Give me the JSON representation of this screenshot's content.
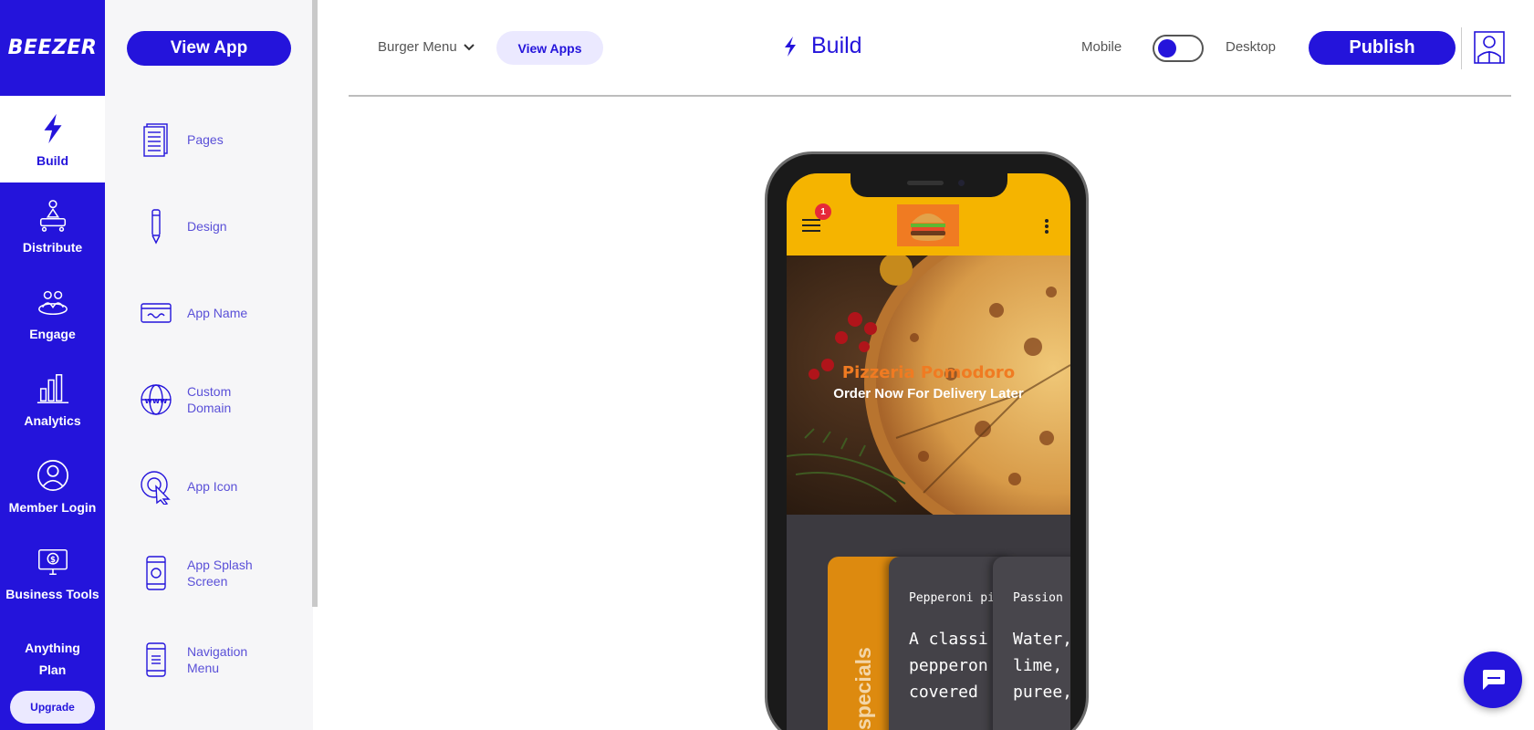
{
  "rail": {
    "logo": "BEEZER",
    "items": [
      {
        "label": "Build",
        "icon": "lightning-icon"
      },
      {
        "label": "Distribute",
        "icon": "distribute-icon"
      },
      {
        "label": "Engage",
        "icon": "engage-icon"
      },
      {
        "label": "Analytics",
        "icon": "analytics-icon"
      },
      {
        "label": "Member Login",
        "icon": "member-icon"
      },
      {
        "label": "Business Tools",
        "icon": "business-tools-icon"
      }
    ],
    "plan_line1": "Anything",
    "plan_line2": "Plan",
    "upgrade_label": "Upgrade"
  },
  "panel": {
    "view_app_label": "View App",
    "items": [
      {
        "label": "Pages",
        "icon": "pages-icon"
      },
      {
        "label": "Design",
        "icon": "pencil-icon"
      },
      {
        "label": "App Name",
        "icon": "app-name-icon"
      },
      {
        "label": "Custom Domain",
        "icon": "www-icon"
      },
      {
        "label": "App Icon",
        "icon": "app-icon-cursor-icon"
      },
      {
        "label": "App Splash Screen",
        "icon": "splash-screen-icon"
      },
      {
        "label": "Navigation Menu",
        "icon": "navigation-menu-icon"
      }
    ]
  },
  "topbar": {
    "nav_type": "Burger Menu",
    "view_apps_label": "View Apps",
    "title": "Build",
    "mobile_label": "Mobile",
    "desktop_label": "Desktop",
    "publish_label": "Publish"
  },
  "phone": {
    "badge_count": "1",
    "hero_title": "Pizzeria Pomodoro",
    "hero_subtitle": "Order Now For Delivery Later",
    "specials_label": "specials",
    "card1_title": "Pepperoni pi",
    "card1_desc": "A classi\npepperon\ncovered",
    "card2_title": "Passion",
    "card2_desc": "Water,\nlime,\npuree,"
  },
  "colors": {
    "brand": "#2414db",
    "app_header": "#f5b400",
    "accent_orange": "#f07b22"
  }
}
